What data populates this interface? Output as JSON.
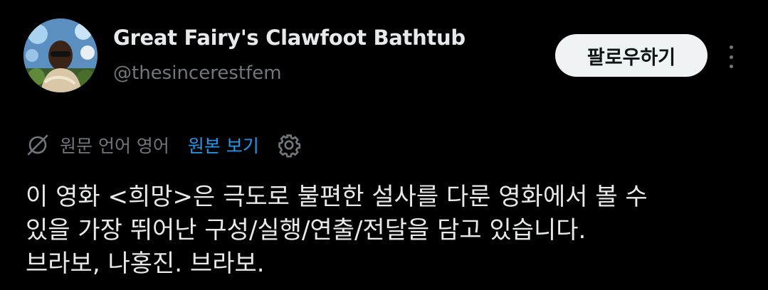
{
  "author": {
    "display_name": "Great Fairy's Clawfoot Bathtub",
    "handle": "@thesincerestfem"
  },
  "actions": {
    "follow_label": "팔로우하기"
  },
  "translation": {
    "original_language_label": "원문 언어 영어",
    "view_original_label": "원본 보기"
  },
  "tweet": {
    "lines": [
      "이 영화 <희망>은 극도로 불편한 설사를 다룬 영화에서 볼 수",
      "있을 가장 뛰어난 구성/실행/연출/전달을 담고 있습니다.",
      "브라보, 나홍진. 브라보."
    ]
  },
  "colors": {
    "background": "#000000",
    "primary_text": "#e7e9ea",
    "secondary_text": "#71767b",
    "link": "#1d9bf0",
    "button_bg": "#eff3f4"
  },
  "icons": {
    "avatar": "profile-photo",
    "translate": "no-translate-icon",
    "settings": "gear-icon",
    "more": "more-vertical-icon"
  }
}
